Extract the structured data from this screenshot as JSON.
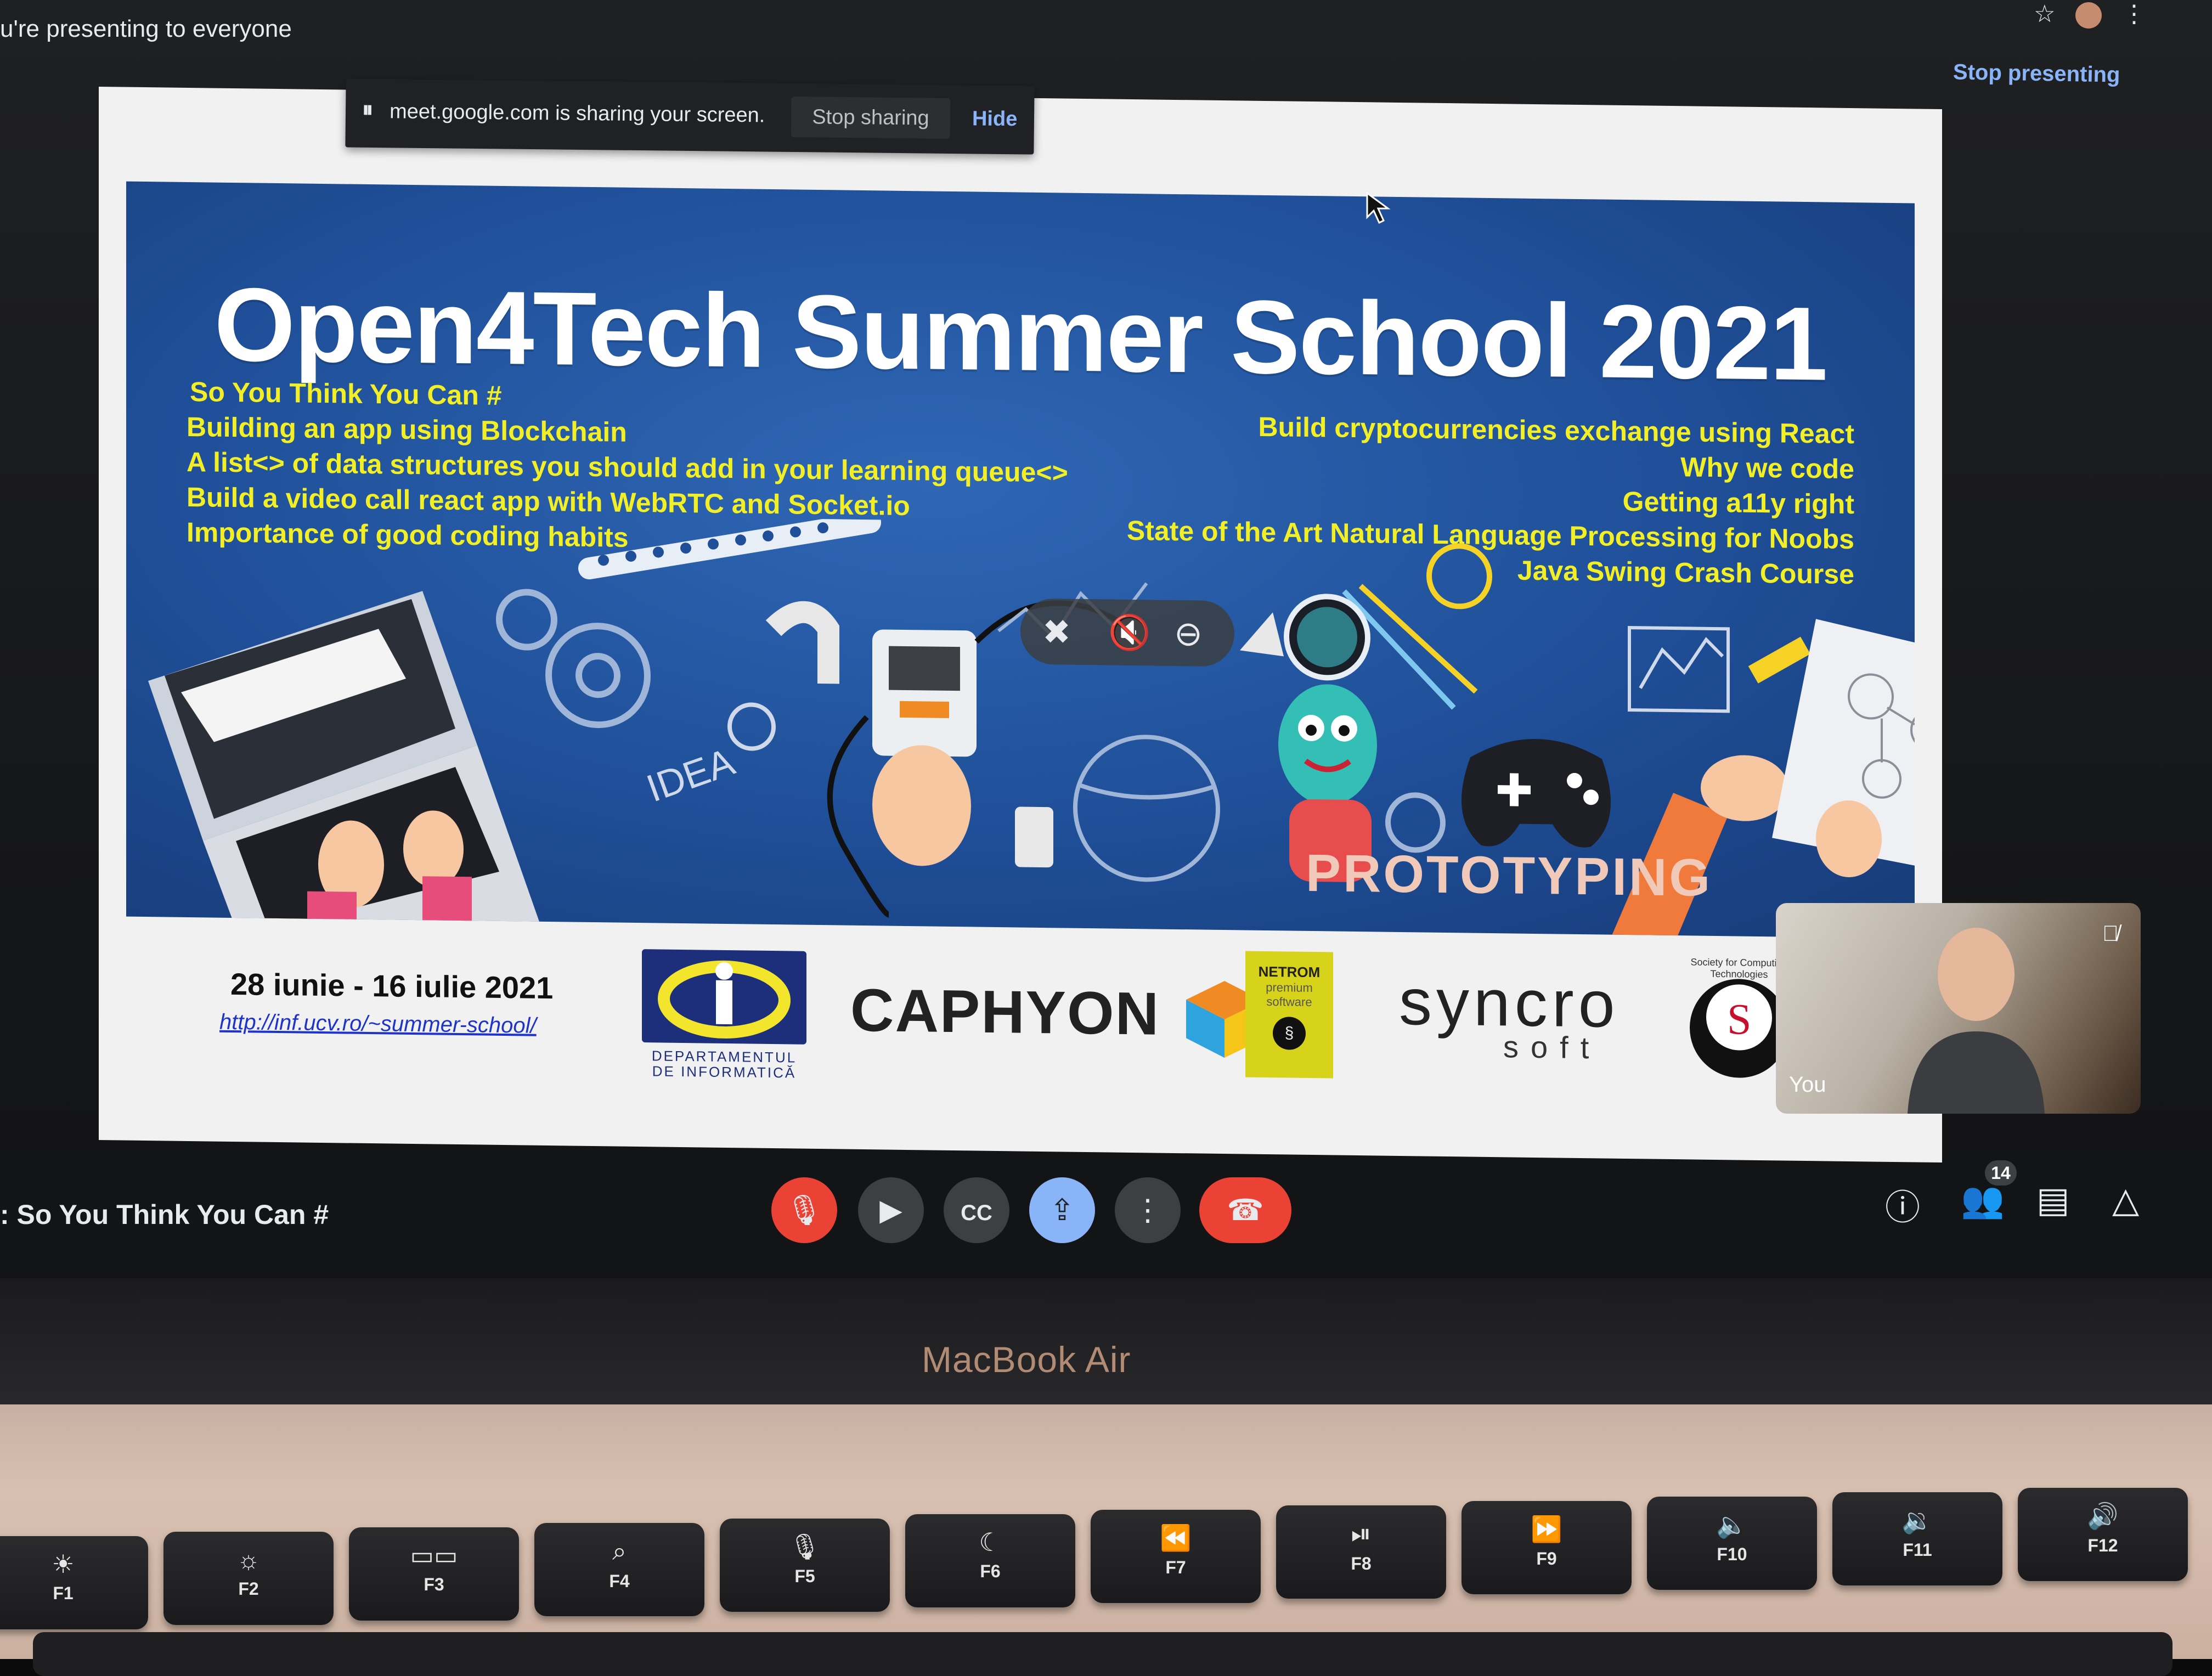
{
  "meet": {
    "top_status": "u're presenting to everyone",
    "stop_presenting": "Stop presenting",
    "meeting_name": ": So You Think You Can #",
    "participants_count": "14",
    "self_label": "You"
  },
  "sharebar": {
    "pause_glyph": "⏸",
    "message": "meet.google.com is sharing your screen.",
    "stop_sharing": "Stop sharing",
    "hide": "Hide"
  },
  "slide": {
    "title": "Open4Tech Summer School 2021",
    "talks_left": [
      "So You Think You Can #",
      "Building an app using Blockchain",
      "A list<> of data structures you should add in your learning queue<>",
      "Build a video call react app with WebRTC and Socket.io",
      "Importance of good coding habits"
    ],
    "talks_right": [
      "Build cryptocurrencies exchange using React",
      "Why we code",
      "Getting a11y right",
      "State of the Art Natural Language Processing for Noobs",
      "Java Swing Crash Course"
    ],
    "illustration_words": {
      "idea": "IDEA",
      "prototyping": "PROTOTYPING"
    },
    "dates": "28 iunie - 16 iulie 2021",
    "url": "http://inf.ucv.ro/~summer-school/",
    "sponsors": {
      "dinf_caption": "DEPARTAMENTUL DE INFORMATICĂ",
      "caphyon": "CAPHYON",
      "netrom_line1": "NETROM",
      "netrom_line2": "premium",
      "netrom_line3": "software",
      "syncro_line1": "syncro",
      "syncro_line2": "soft",
      "sct_ring": "Society for Computing Technologies"
    }
  },
  "laptop": {
    "brand": "MacBook Air",
    "keys": [
      {
        "label": "F1",
        "icon": "☀"
      },
      {
        "label": "F2",
        "icon": "☼"
      },
      {
        "label": "F3",
        "icon": "▭▭"
      },
      {
        "label": "F4",
        "icon": "⌕"
      },
      {
        "label": "F5",
        "icon": "🎙"
      },
      {
        "label": "F6",
        "icon": "☾"
      },
      {
        "label": "F7",
        "icon": "⏪"
      },
      {
        "label": "F8",
        "icon": "⏯"
      },
      {
        "label": "F9",
        "icon": "⏩"
      },
      {
        "label": "F10",
        "icon": "🔈"
      },
      {
        "label": "F11",
        "icon": "🔉"
      },
      {
        "label": "F12",
        "icon": "🔊"
      }
    ]
  },
  "colors": {
    "accent_blue": "#8ab4f8",
    "danger_red": "#ea4335",
    "slide_yellow": "#f3ef27"
  }
}
